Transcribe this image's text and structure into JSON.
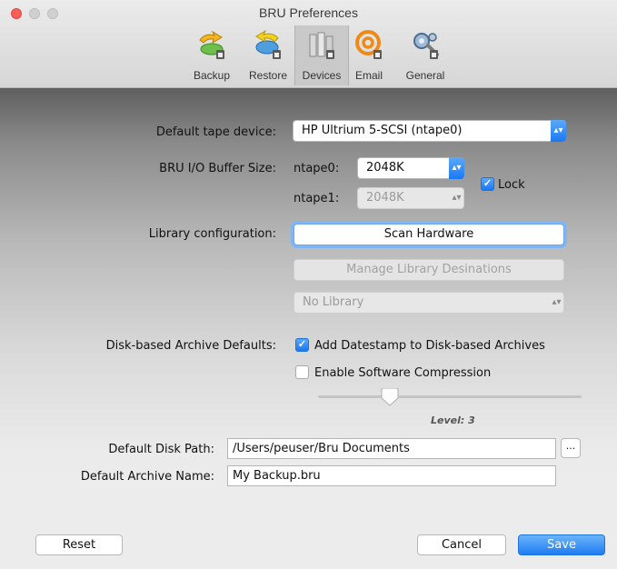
{
  "window": {
    "title": "BRU Preferences"
  },
  "toolbar": {
    "items": [
      {
        "label": "Backup",
        "icon": "backup-icon"
      },
      {
        "label": "Restore",
        "icon": "restore-icon"
      },
      {
        "label": "Devices",
        "icon": "devices-icon",
        "selected": true
      },
      {
        "label": "Email",
        "icon": "email-icon"
      },
      {
        "label": "General",
        "icon": "general-icon"
      }
    ]
  },
  "devices": {
    "default_tape_label": "Default tape device:",
    "default_tape_value": "HP Ultrium 5-SCSI (ntape0)",
    "buffer_label": "BRU I/O Buffer Size:",
    "ntape0_label": "ntape0:",
    "ntape0_value": "2048K",
    "ntape1_label": "ntape1:",
    "ntape1_value": "2048K",
    "lock_label": "Lock",
    "lock_checked": true,
    "library_label": "Library configuration:",
    "scan_button": "Scan Hardware",
    "manage_button": "Manage Library Desinations",
    "library_select": "No Library",
    "disk_defaults_label": "Disk-based Archive Defaults:",
    "datestamp_label": "Add Datestamp to Disk-based Archives",
    "datestamp_checked": true,
    "compression_label": "Enable Software Compression",
    "compression_checked": false,
    "compression_level": 3,
    "level_text": "Level: 3",
    "disk_path_label": "Default Disk Path:",
    "disk_path_value": "/Users/peuser/Bru Documents",
    "browse_button": "...",
    "archive_name_label": "Default Archive Name:",
    "archive_name_value": "My Backup.bru"
  },
  "footer": {
    "reset_button": "Reset",
    "cancel_button": "Cancel",
    "save_button": "Save"
  },
  "colors": {
    "accent": "#1a78f2",
    "focus_ring": "#7fb6f5"
  }
}
